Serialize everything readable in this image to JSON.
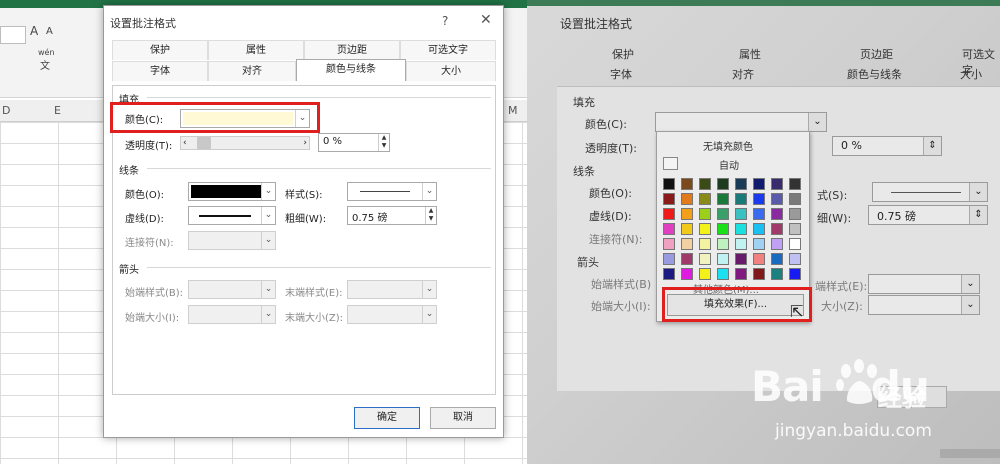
{
  "left": {
    "ribbon": {
      "font_grow": "A",
      "font_shrink": "A",
      "wen": "wén",
      "wen_sub": "文"
    },
    "columns": [
      "D",
      "E",
      "M"
    ],
    "dialog": {
      "title": "设置批注格式",
      "help": "?",
      "close": "✕",
      "tabs_row1": [
        "保护",
        "属性",
        "页边距",
        "可选文字"
      ],
      "tabs_row2": [
        "字体",
        "对齐",
        "颜色与线条",
        "大小"
      ],
      "active_tab": "颜色与线条",
      "fill": {
        "section": "填充",
        "color_label": "颜色(C):",
        "color_value": "#fff9d6",
        "transparency_label": "透明度(T):",
        "transparency_value": "0 %"
      },
      "line": {
        "section": "线条",
        "color_label": "颜色(O):",
        "color_value": "#000000",
        "style_label": "样式(S):",
        "dash_label": "虚线(D):",
        "weight_label": "粗细(W):",
        "weight_value": "0.75 磅",
        "connector_label": "连接符(N):"
      },
      "arrows": {
        "section": "箭头",
        "begin_style": "始端样式(B):",
        "end_style": "末端样式(E):",
        "begin_size": "始端大小(I):",
        "end_size": "末端大小(Z):"
      },
      "ok": "确定",
      "cancel": "取消"
    }
  },
  "right": {
    "title": "设置批注格式",
    "tabs_row1": [
      "保护",
      "属性",
      "页边距",
      "可选文字"
    ],
    "tabs_row2": [
      "字体",
      "对齐",
      "颜色与线条",
      "大小"
    ],
    "fill_section": "填充",
    "color_label": "颜色(C):",
    "transparency_label": "透明度(T):",
    "transparency_value": "0 %",
    "line_section": "线条",
    "line_color_label": "颜色(O):",
    "dash_label": "虚线(D):",
    "style_label": "式(S):",
    "weight_label": "细(W):",
    "weight_value": "0.75 磅",
    "connector_label": "连接符(N):",
    "arrows_section": "箭头",
    "begin_style": "始端样式(B)",
    "begin_size": "始端大小(I):",
    "end_style": "端样式(E):",
    "end_size": "大小(Z):",
    "popup": {
      "no_fill": "无填充颜色",
      "auto": "自动",
      "more_colors": "其他颜色(M)...",
      "fill_effects": "填充效果(F)...",
      "palette": [
        [
          "#111111",
          "#7a4a1c",
          "#3b4a16",
          "#1d3b1d",
          "#1a3a5a",
          "#111c6e",
          "#3a2a6e",
          "#333333"
        ],
        [
          "#8a1a1a",
          "#e07a1a",
          "#8a8a1a",
          "#1a7a3a",
          "#1a7a7a",
          "#1a3aee",
          "#5a5aaa",
          "#7a7a7a"
        ],
        [
          "#ee1a1a",
          "#f2a01a",
          "#9ad01a",
          "#3aa06a",
          "#3ac0c0",
          "#3a6aee",
          "#8a2aa0",
          "#9a9a9a"
        ],
        [
          "#e040c0",
          "#f2c81a",
          "#f2f21a",
          "#1ae01a",
          "#1ae0e0",
          "#1ac0f2",
          "#a03a6a",
          "#c0c0c0"
        ],
        [
          "#f0a0c0",
          "#f2d0a0",
          "#f2f2a0",
          "#c0f2c0",
          "#c0f2f2",
          "#a0d0f2",
          "#c0a0f2",
          "#ffffff"
        ],
        [
          "#9a9ae0",
          "#a03a6a",
          "#f2f2c0",
          "#c0f2f2",
          "#6a1a6a",
          "#f28080",
          "#1a6ac0",
          "#c0c0f2"
        ],
        [
          "#1a1a80",
          "#e01ae0",
          "#f2f21a",
          "#1ae0f2",
          "#801a80",
          "#801a1a",
          "#1a8080",
          "#1a1af2"
        ]
      ]
    },
    "watermark": {
      "logo": "Bai",
      "logo2": "du",
      "cn": "经验",
      "url": "jingyan.baidu.com"
    }
  }
}
